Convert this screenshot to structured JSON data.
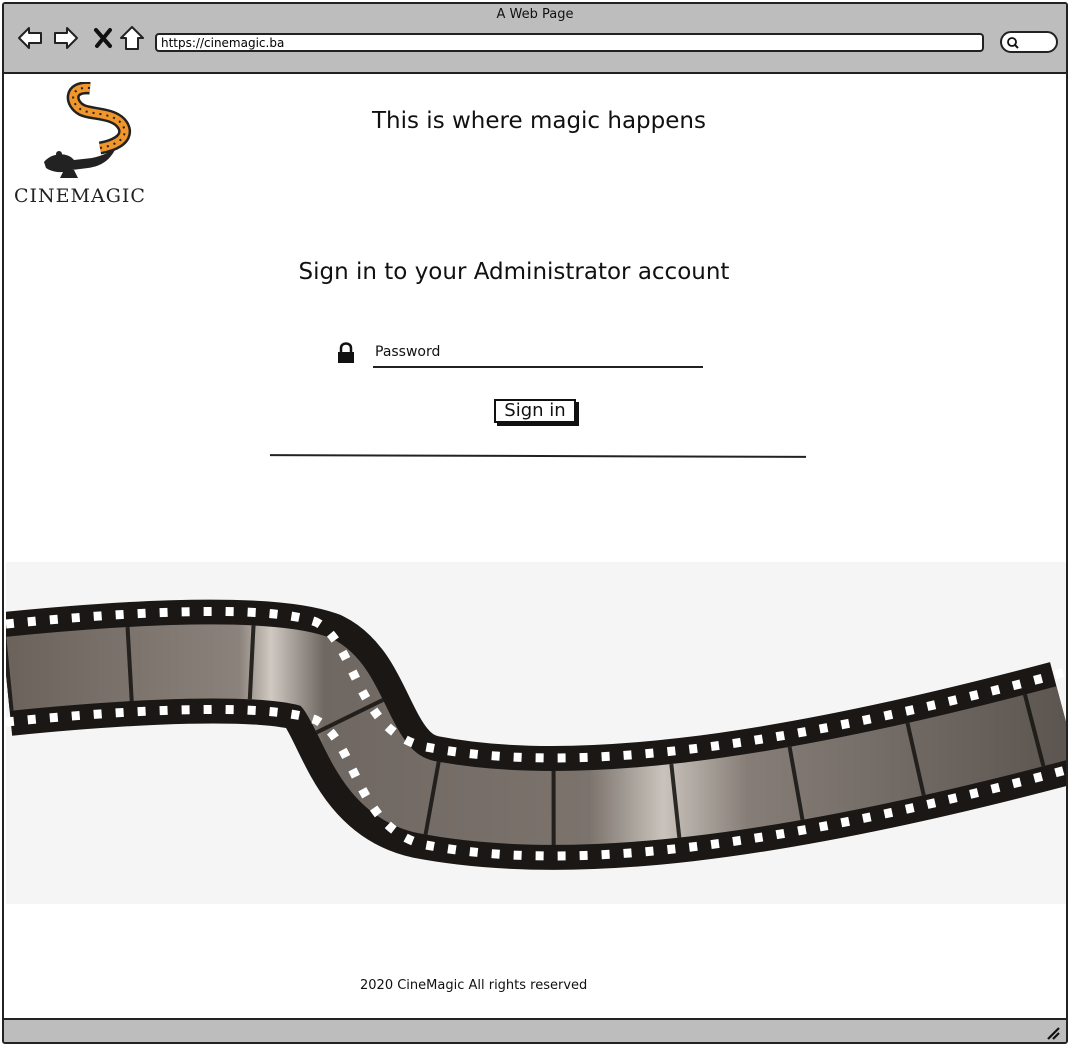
{
  "window": {
    "title": "A Web Page"
  },
  "toolbar": {
    "back_icon": "back-arrow-icon",
    "forward_icon": "forward-arrow-icon",
    "stop_icon": "close-x-icon",
    "home_icon": "home-icon",
    "url": "https://cinemagic.ba",
    "search_icon": "search-icon"
  },
  "brand": {
    "logo_text": "CINEMAGIC"
  },
  "header": {
    "tagline": "This is where magic happens"
  },
  "login": {
    "title": "Sign in to your Administrator account",
    "password_placeholder": "Password",
    "password_value": "",
    "submit_label": "Sign in",
    "lock_icon": "lock-icon"
  },
  "banner": {
    "image": "film-strip"
  },
  "footer": {
    "text": "2020 CineMagic All rights reserved"
  }
}
